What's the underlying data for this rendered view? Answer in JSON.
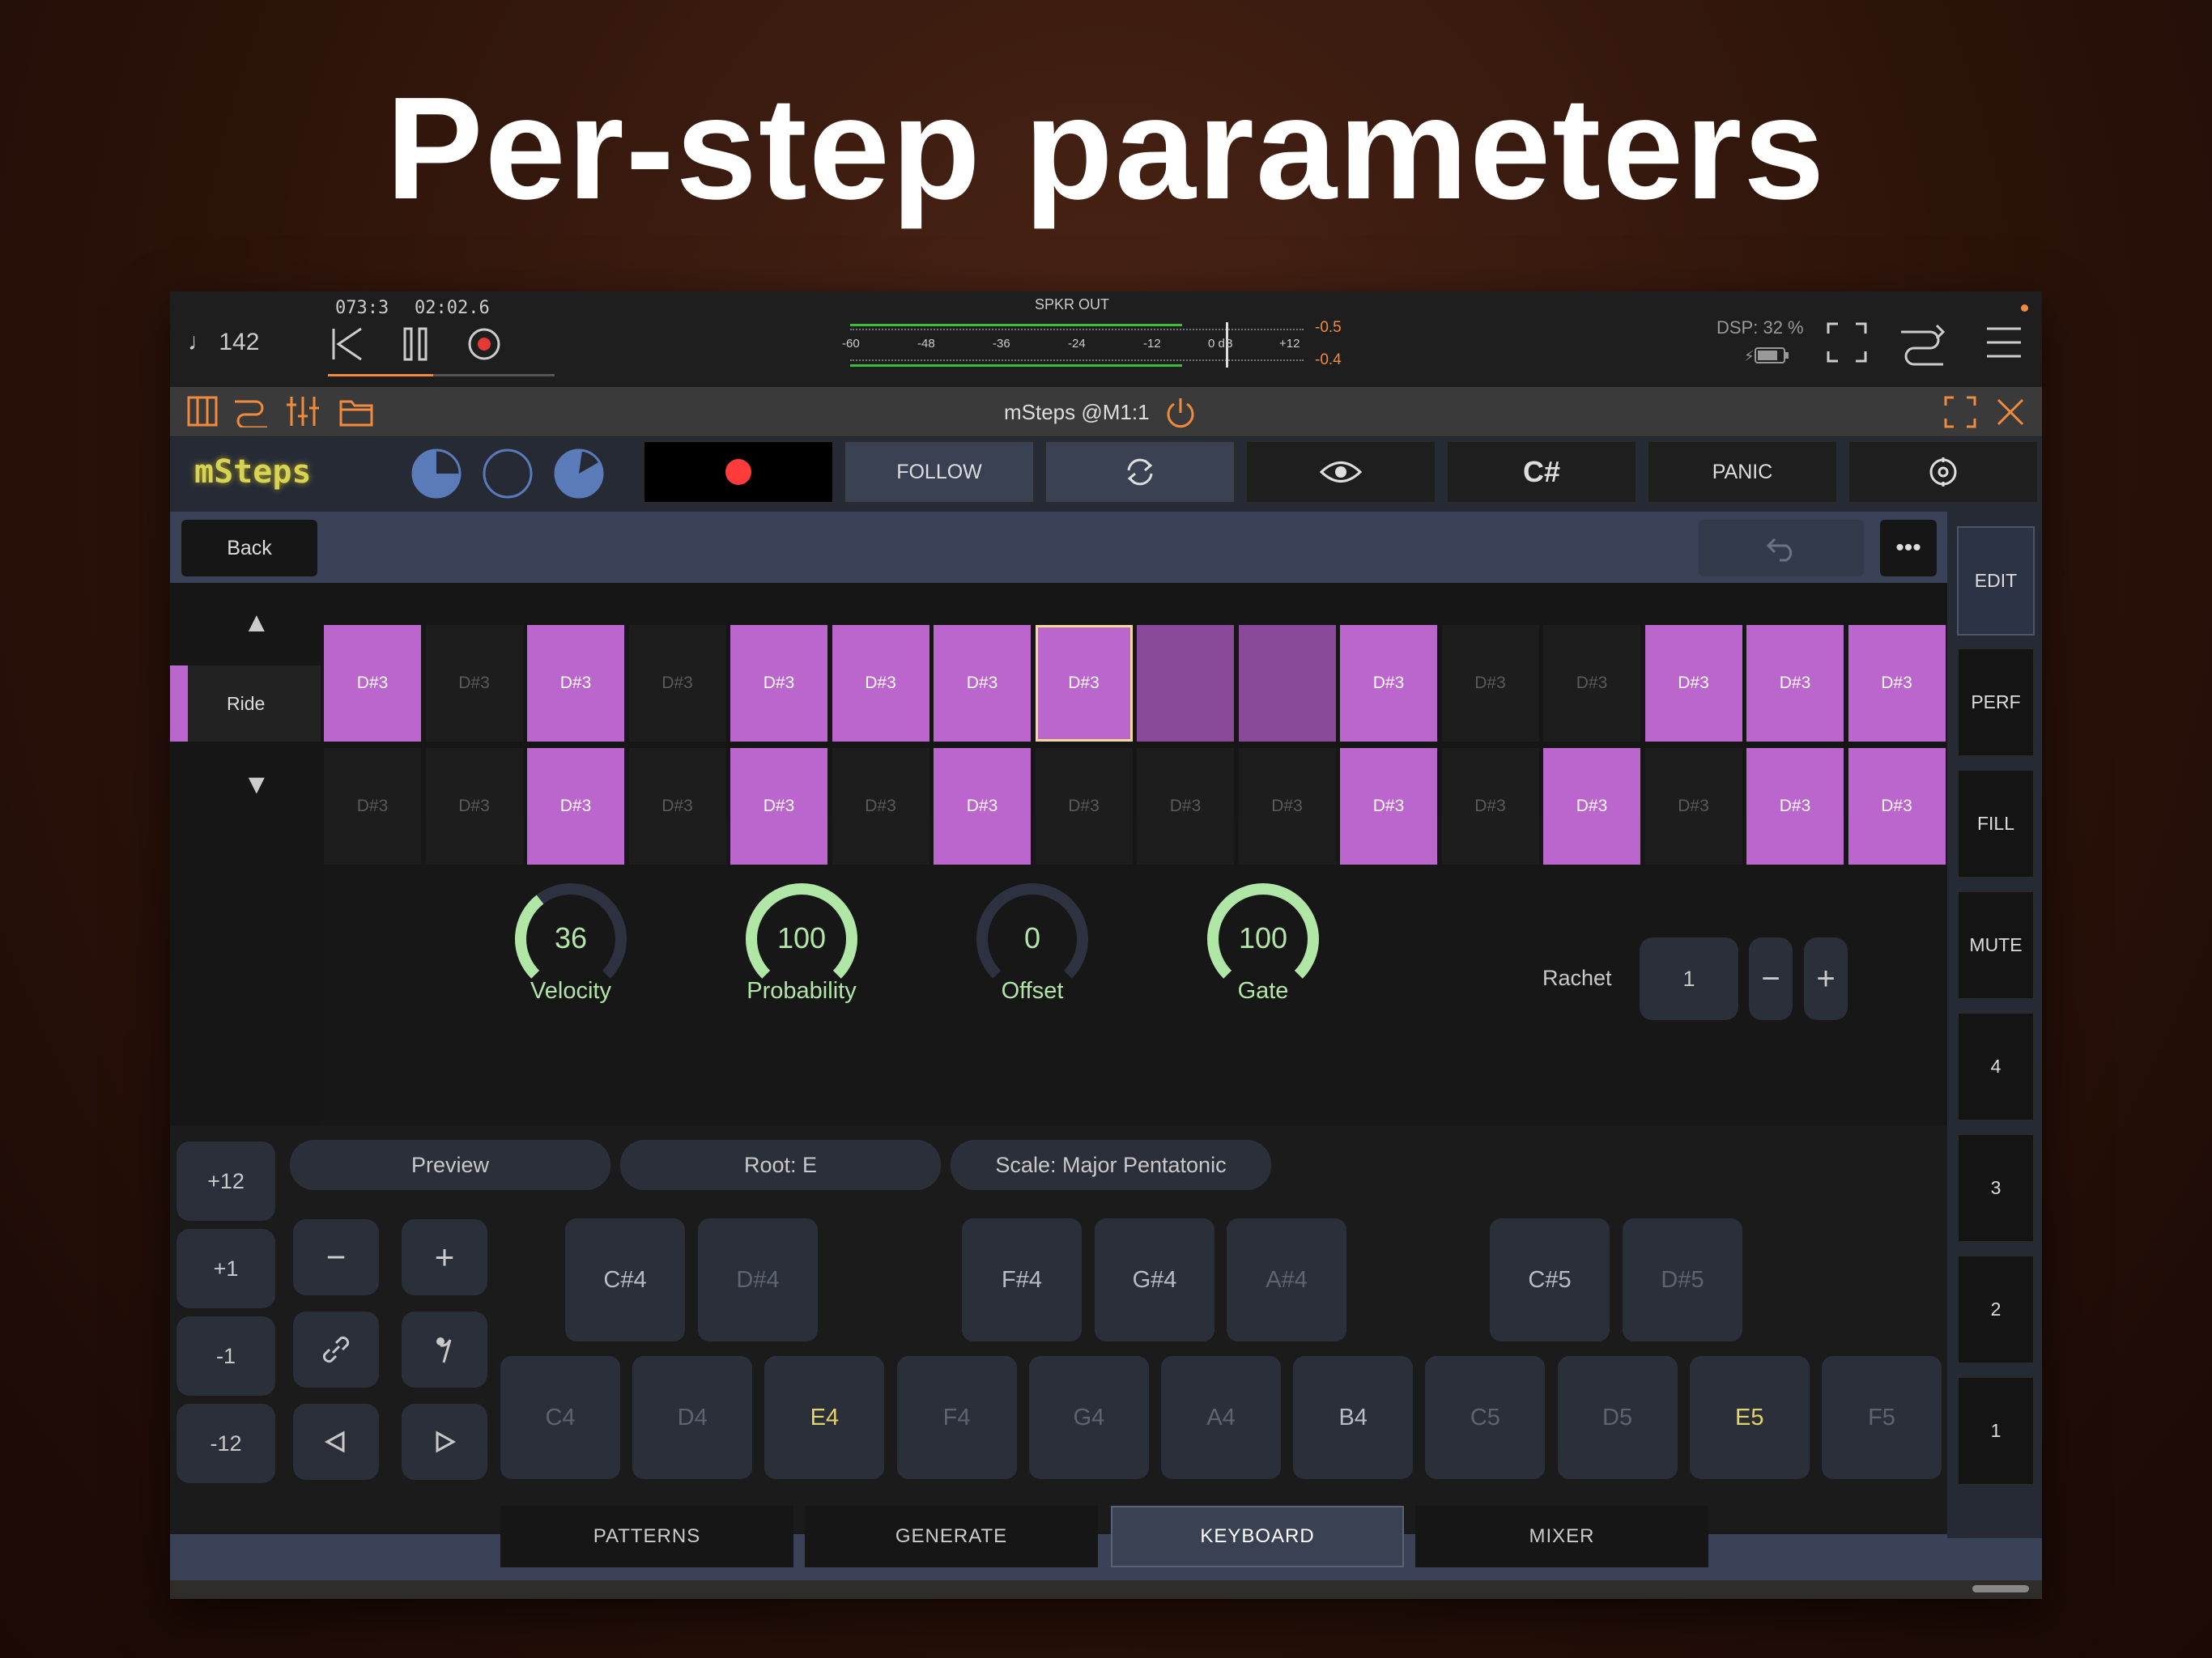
{
  "headline": "Per-step parameters",
  "host": {
    "tempo": "♩ 142",
    "position": "073:3",
    "time": "02:02.6",
    "meter_title": "SPKR OUT",
    "meter_ticks": [
      "-60",
      "-48",
      "-36",
      "-24",
      "-12",
      "0 dB",
      "+12"
    ],
    "peak_top": "-0.5",
    "peak_bottom": "-0.4",
    "dsp": "DSP: 32 %"
  },
  "auv3": {
    "title": "mSteps @M1:1"
  },
  "plugin": {
    "logo": "mSteps",
    "follow": "FOLLOW",
    "key": "C#",
    "panic": "PANIC",
    "back": "Back",
    "side": [
      "EDIT",
      "PERF",
      "FILL",
      "MUTE",
      "4",
      "3",
      "2",
      "1"
    ],
    "track": "Ride",
    "row1": [
      {
        "label": "D#3",
        "state": "on"
      },
      {
        "label": "D#3",
        "state": "off"
      },
      {
        "label": "D#3",
        "state": "on"
      },
      {
        "label": "D#3",
        "state": "off"
      },
      {
        "label": "D#3",
        "state": "on"
      },
      {
        "label": "D#3",
        "state": "on"
      },
      {
        "label": "D#3",
        "state": "on"
      },
      {
        "label": "D#3",
        "state": "sel"
      },
      {
        "label": "",
        "state": "dim"
      },
      {
        "label": "",
        "state": "dim"
      },
      {
        "label": "D#3",
        "state": "on"
      },
      {
        "label": "D#3",
        "state": "off"
      },
      {
        "label": "D#3",
        "state": "off"
      },
      {
        "label": "D#3",
        "state": "on"
      },
      {
        "label": "D#3",
        "state": "on"
      },
      {
        "label": "D#3",
        "state": "on"
      }
    ],
    "row2": [
      {
        "label": "D#3",
        "state": "off"
      },
      {
        "label": "D#3",
        "state": "off"
      },
      {
        "label": "D#3",
        "state": "on"
      },
      {
        "label": "D#3",
        "state": "off"
      },
      {
        "label": "D#3",
        "state": "on"
      },
      {
        "label": "D#3",
        "state": "off"
      },
      {
        "label": "D#3",
        "state": "on"
      },
      {
        "label": "D#3",
        "state": "off"
      },
      {
        "label": "D#3",
        "state": "off"
      },
      {
        "label": "D#3",
        "state": "off"
      },
      {
        "label": "D#3",
        "state": "on"
      },
      {
        "label": "D#3",
        "state": "off"
      },
      {
        "label": "D#3",
        "state": "on"
      },
      {
        "label": "D#3",
        "state": "off"
      },
      {
        "label": "D#3",
        "state": "on"
      },
      {
        "label": "D#3",
        "state": "on"
      }
    ],
    "knobs": [
      {
        "label": "Velocity",
        "value": "36",
        "fraction": 0.36
      },
      {
        "label": "Probability",
        "value": "100",
        "fraction": 1.0
      },
      {
        "label": "Offset",
        "value": "0",
        "fraction": 0.0
      },
      {
        "label": "Gate",
        "value": "100",
        "fraction": 1.0
      }
    ],
    "rachet": {
      "label": "Rachet",
      "value": "1"
    },
    "preview": "Preview",
    "root": "Root: E",
    "scale": "Scale: Major Pentatonic",
    "octave": [
      "+12",
      "+1",
      "-1",
      "-12"
    ],
    "black_keys": [
      {
        "label": "C#4",
        "state": "in"
      },
      {
        "label": "D#4",
        "state": "out"
      },
      {
        "label": "F#4",
        "state": "in"
      },
      {
        "label": "G#4",
        "state": "in"
      },
      {
        "label": "A#4",
        "state": "out"
      },
      {
        "label": "C#5",
        "state": "in"
      },
      {
        "label": "D#5",
        "state": "out"
      }
    ],
    "white_keys": [
      {
        "label": "C4",
        "state": "out"
      },
      {
        "label": "D4",
        "state": "out"
      },
      {
        "label": "E4",
        "state": "root"
      },
      {
        "label": "F4",
        "state": "out"
      },
      {
        "label": "G4",
        "state": "out"
      },
      {
        "label": "A4",
        "state": "out"
      },
      {
        "label": "B4",
        "state": "in"
      },
      {
        "label": "C5",
        "state": "out"
      },
      {
        "label": "D5",
        "state": "out"
      },
      {
        "label": "E5",
        "state": "root"
      },
      {
        "label": "F5",
        "state": "out"
      }
    ],
    "tabs": [
      "PATTERNS",
      "GENERATE",
      "KEYBOARD",
      "MIXER"
    ],
    "active_tab": "KEYBOARD"
  },
  "colors": {
    "step_on": "#bb66cc",
    "step_dim": "#8a4a9a",
    "knob": "#b0e6a6",
    "accent": "#f08a3c",
    "record": "#ff3b3b"
  }
}
